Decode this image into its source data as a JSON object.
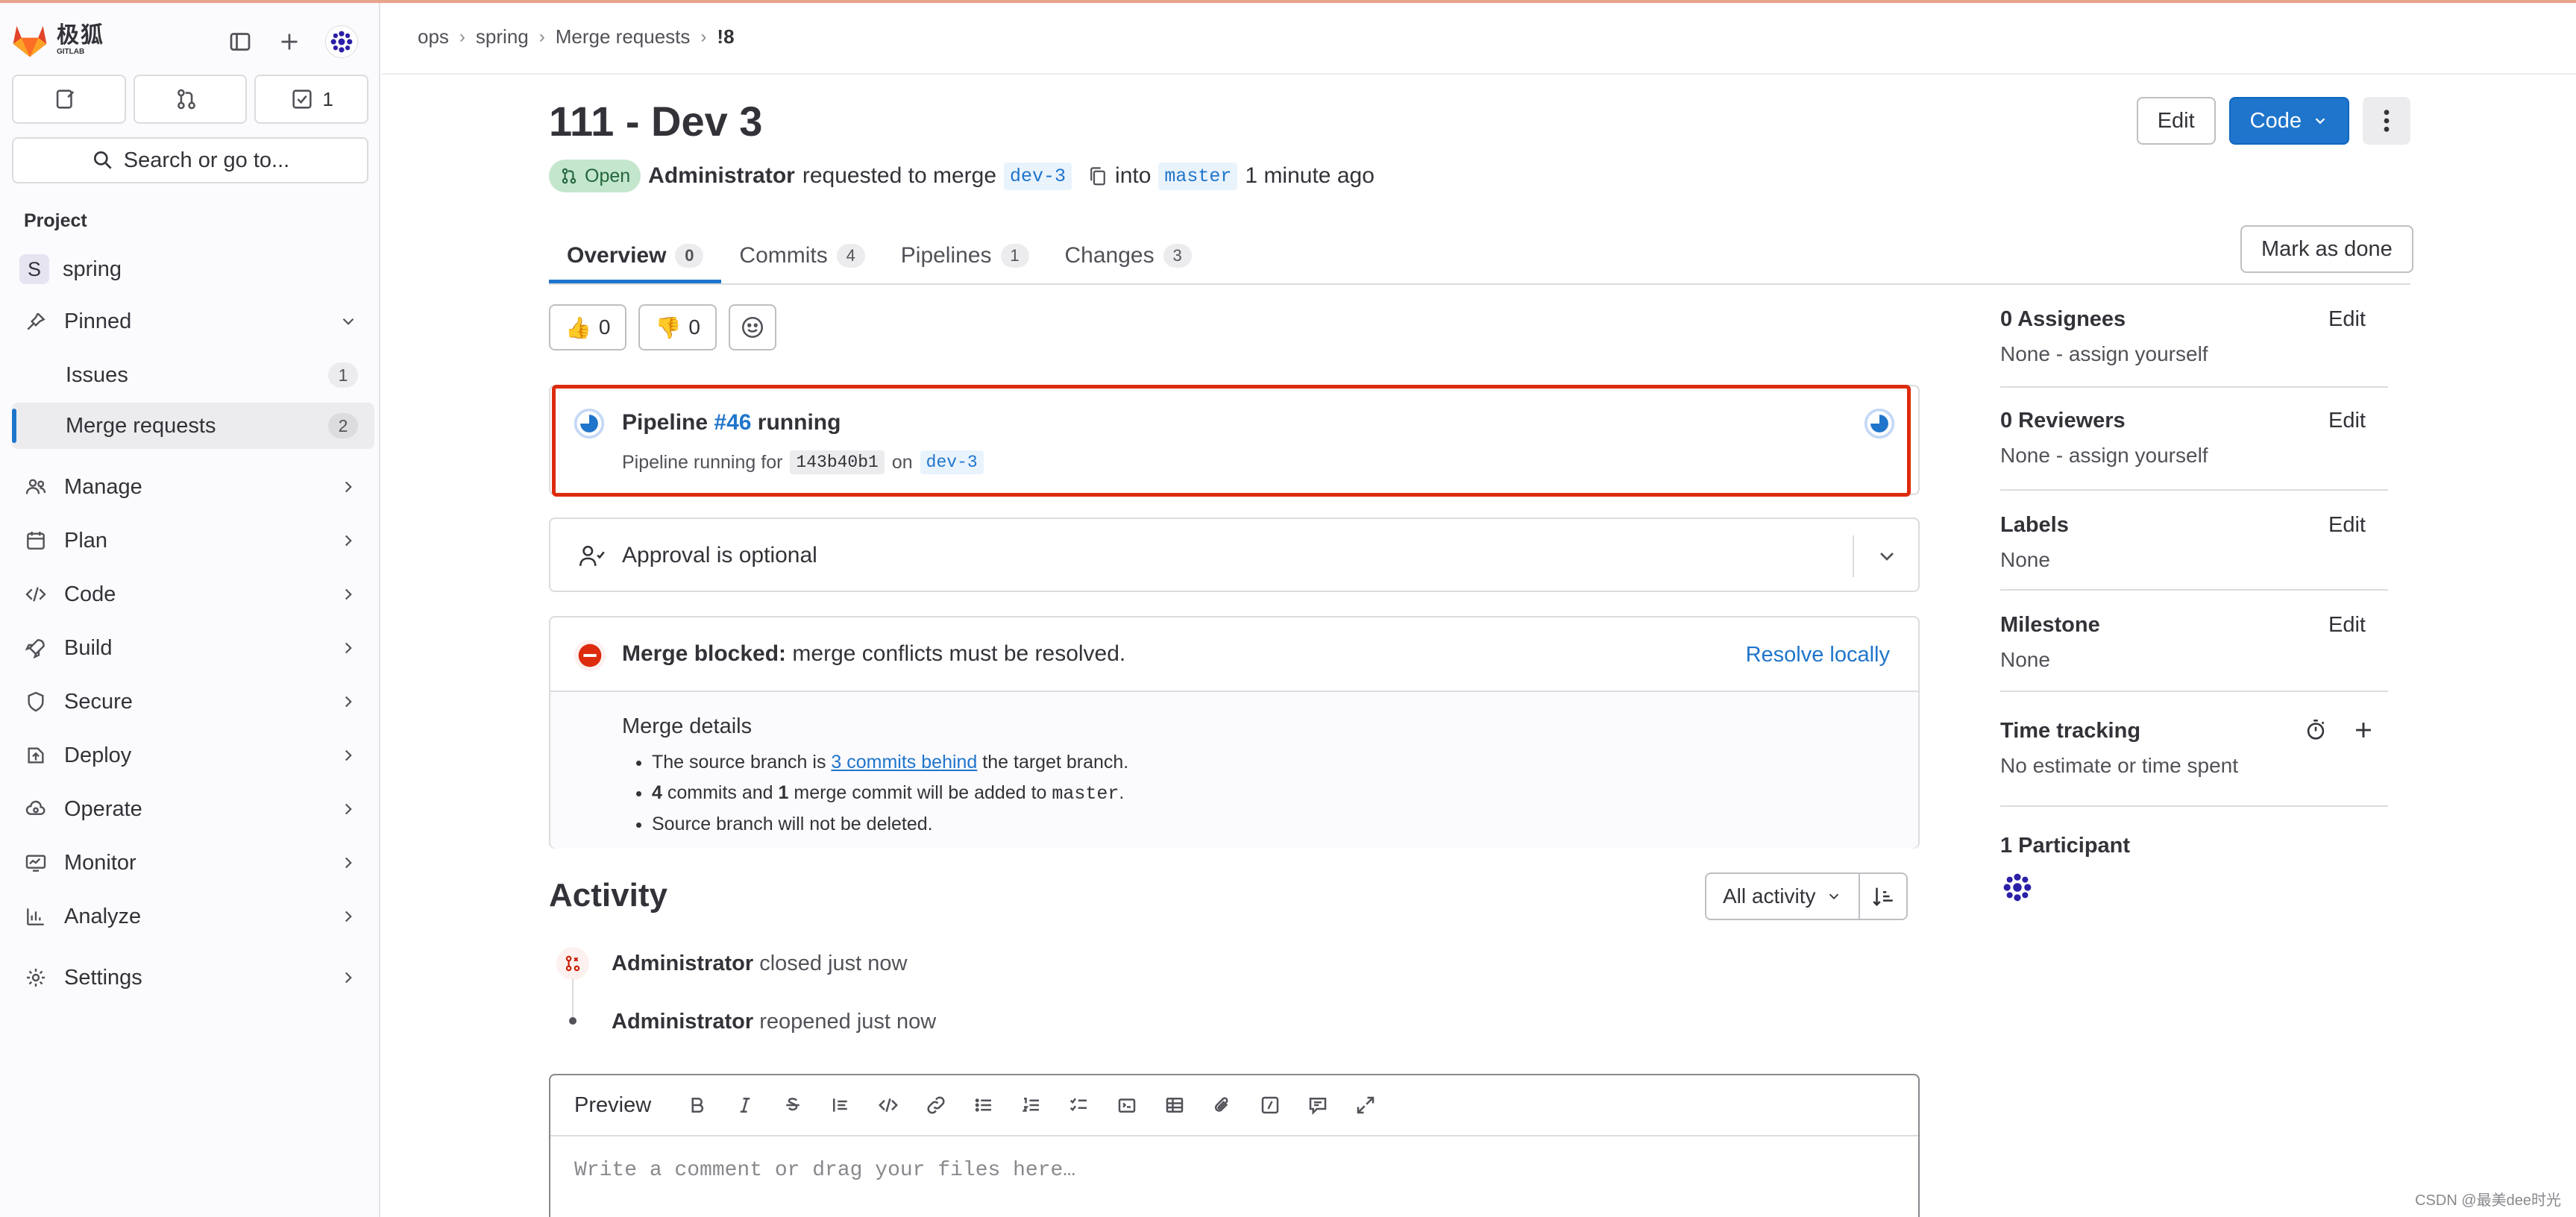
{
  "brand": {
    "name_cn": "极狐",
    "name_en": "GITLAB",
    "accent": "#1f75cb",
    "alert": "#dd2b0e"
  },
  "sidebar": {
    "counts": {
      "issues": "",
      "merge_requests": "",
      "todos": "1"
    },
    "search_label": "Search or go to...",
    "section_label": "Project",
    "project": {
      "initial": "S",
      "name": "spring"
    },
    "pinned": {
      "label": "Pinned",
      "items": [
        {
          "label": "Issues",
          "count": "1"
        },
        {
          "label": "Merge requests",
          "count": "2"
        }
      ]
    },
    "items": [
      {
        "label": "Manage"
      },
      {
        "label": "Plan"
      },
      {
        "label": "Code"
      },
      {
        "label": "Build"
      },
      {
        "label": "Secure"
      },
      {
        "label": "Deploy"
      },
      {
        "label": "Operate"
      },
      {
        "label": "Monitor"
      },
      {
        "label": "Analyze"
      },
      {
        "label": "Settings"
      }
    ]
  },
  "breadcrumb": [
    "ops",
    "spring",
    "Merge requests",
    "!8"
  ],
  "header": {
    "title": "111 - Dev 3",
    "edit_label": "Edit",
    "code_label": "Code",
    "status": "Open",
    "author": "Administrator",
    "requested_text": "requested to merge",
    "source_branch": "dev-3",
    "into_text": "into",
    "target_branch": "master",
    "time": "1 minute ago"
  },
  "tabs": [
    {
      "label": "Overview",
      "count": "0"
    },
    {
      "label": "Commits",
      "count": "4"
    },
    {
      "label": "Pipelines",
      "count": "1"
    },
    {
      "label": "Changes",
      "count": "3"
    }
  ],
  "mark_done_label": "Mark as done",
  "reactions": {
    "thumbs_up": "0",
    "thumbs_down": "0"
  },
  "pipeline": {
    "prefix": "Pipeline",
    "id": "#46",
    "status": "running",
    "sub_prefix": "Pipeline running for",
    "commit": "143b40b1",
    "on_text": "on",
    "branch": "dev-3"
  },
  "approval": {
    "text": "Approval is optional"
  },
  "merge": {
    "blocked_bold": "Merge blocked:",
    "blocked_text": "merge conflicts must be resolved.",
    "resolve_label": "Resolve locally",
    "details_title": "Merge details",
    "line1_prefix": "The source branch is",
    "line1_link": "3 commits behind",
    "line1_suffix": "the target branch.",
    "line2_commits": "4",
    "line2_mid": "commits and",
    "line2_merge": "1",
    "line2_suffix": "merge commit will be added to",
    "line2_branch": "master",
    "line3": "Source branch will not be deleted."
  },
  "activity": {
    "title": "Activity",
    "filter_label": "All activity",
    "events": [
      {
        "actor": "Administrator",
        "action": "closed just now"
      },
      {
        "actor": "Administrator",
        "action": "reopened just now"
      }
    ]
  },
  "comment": {
    "preview_label": "Preview",
    "placeholder": "Write a comment or drag your files here…"
  },
  "right_sidebar": {
    "assignees": {
      "title": "0 Assignees",
      "value": "None - assign yourself",
      "edit": "Edit"
    },
    "reviewers": {
      "title": "0 Reviewers",
      "value": "None - assign yourself",
      "edit": "Edit"
    },
    "labels": {
      "title": "Labels",
      "value": "None",
      "edit": "Edit"
    },
    "milestone": {
      "title": "Milestone",
      "value": "None",
      "edit": "Edit"
    },
    "time_tracking": {
      "title": "Time tracking",
      "value": "No estimate or time spent"
    },
    "participants": {
      "title": "1 Participant"
    }
  },
  "watermark": "CSDN @最美dee时光"
}
